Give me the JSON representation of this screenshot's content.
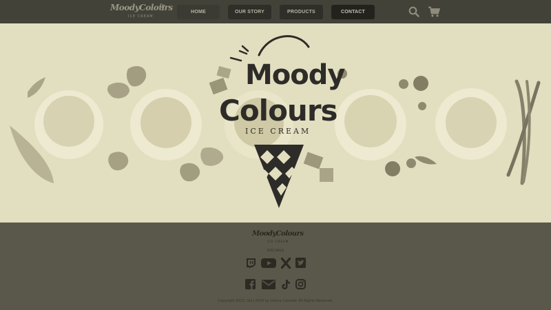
{
  "nav": {
    "logo_text": "MoodyColours",
    "logo_sub": "ICE CREAM",
    "links": [
      "HOME",
      "OUR STORY",
      "PRODUCTS",
      "CONTACT"
    ],
    "icons": [
      "search-icon",
      "cart-icon"
    ]
  },
  "hero": {
    "brand_line1": "Moody",
    "brand_line2": "Colours",
    "brand_sub": "ICE CREAM"
  },
  "footer": {
    "logo_text": "MoodyColours",
    "logo_sub": "ICE CREAM",
    "social_label": "SOCIALS",
    "social_icons_row1": [
      "twitch-icon",
      "youtube-icon",
      "x-icon",
      "twitter-icon"
    ],
    "social_icons_row2": [
      "facebook-icon",
      "email-icon",
      "tiktok-icon",
      "instagram-icon"
    ],
    "copyright": "Copyright 2022. ULLI 2024 by Liliana Caniedo. All Rights Reserved."
  },
  "colors": {
    "nav_bg": "#434239",
    "hero_bg": "#e2dec0",
    "footer_bg": "#5a584a",
    "ink": "#2d2c28"
  }
}
